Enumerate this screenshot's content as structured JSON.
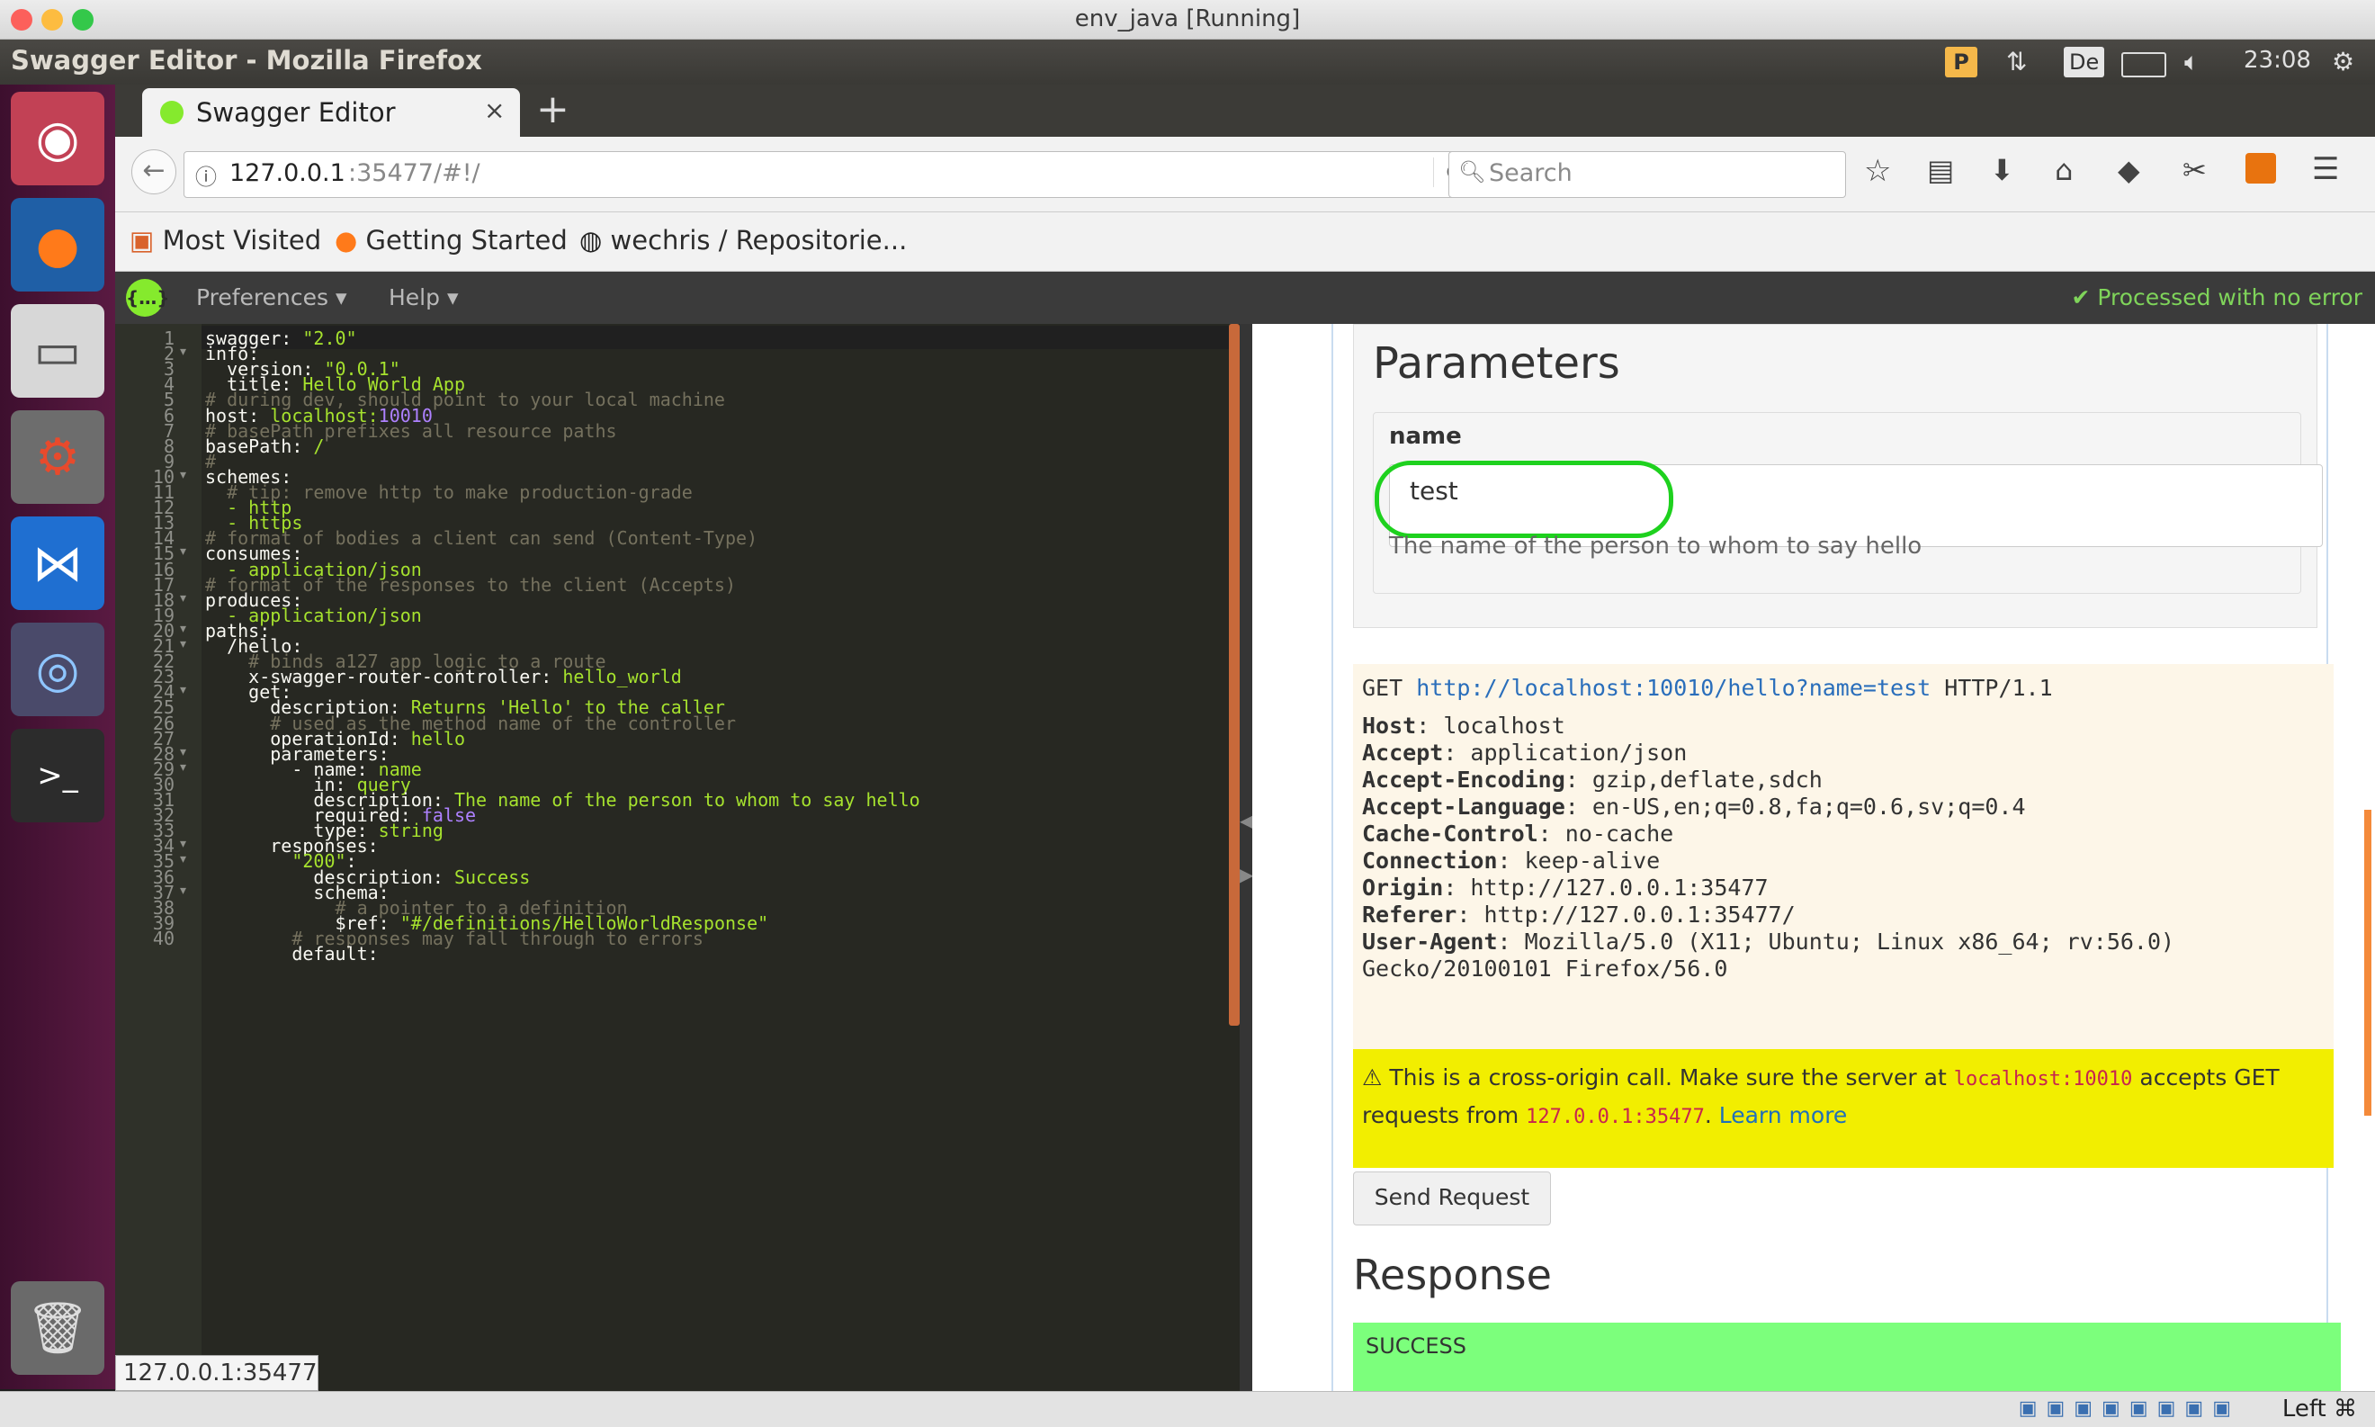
{
  "host_window": {
    "title": "env_java [Running]"
  },
  "ubuntu_panel": {
    "window_title": "Swagger Editor - Mozilla Firefox",
    "keyboard_layout": "De",
    "clock": "23:08"
  },
  "launcher": {
    "items": [
      "ubuntu-dash",
      "firefox",
      "files",
      "system-settings",
      "vscode",
      "chromium",
      "terminal",
      "trash"
    ]
  },
  "browser": {
    "tab_title": "Swagger Editor",
    "url_host": "127.0.0.1",
    "url_rest": ":35477/#!/",
    "search_placeholder": "Search",
    "bookmarks": [
      "Most Visited",
      "Getting Started",
      "wechris / Repositorie..."
    ],
    "status_url": "127.0.0.1:35477"
  },
  "swagger": {
    "menu": [
      "Preferences",
      "Help"
    ],
    "status": "Processed with no error"
  },
  "editor": {
    "line_numbers": [
      "1",
      "2",
      "3",
      "4",
      "5",
      "6",
      "7",
      "8",
      "9",
      "10",
      "11",
      "12",
      "13",
      "14",
      "15",
      "16",
      "17",
      "18",
      "19",
      "20",
      "21",
      "22",
      "23",
      "24",
      "25",
      "26",
      "27",
      "28",
      "29",
      "30",
      "31",
      "32",
      "33",
      "34",
      "35",
      "36",
      "37",
      "38",
      "39",
      "40"
    ],
    "folded_lines": [
      "2",
      "10",
      "15",
      "18",
      "20",
      "21",
      "24",
      "28",
      "29",
      "34",
      "35",
      "37"
    ],
    "lines": [
      [
        {
          "t": "k",
          "v": "swagger: "
        },
        {
          "t": "s",
          "v": "\"2.0\""
        }
      ],
      [
        {
          "t": "k",
          "v": "info:"
        }
      ],
      [
        {
          "t": "k",
          "v": "  version: "
        },
        {
          "t": "s",
          "v": "\"0.0.1\""
        }
      ],
      [
        {
          "t": "k",
          "v": "  title: "
        },
        {
          "t": "s",
          "v": "Hello World App"
        }
      ],
      [
        {
          "t": "c",
          "v": "# during dev, should point to your local machine"
        }
      ],
      [
        {
          "t": "k",
          "v": "host: "
        },
        {
          "t": "s",
          "v": "localhost:"
        },
        {
          "t": "n",
          "v": "10010"
        }
      ],
      [
        {
          "t": "c",
          "v": "# basePath prefixes all resource paths"
        }
      ],
      [
        {
          "t": "k",
          "v": "basePath: "
        },
        {
          "t": "s",
          "v": "/"
        }
      ],
      [
        {
          "t": "c",
          "v": "#"
        }
      ],
      [
        {
          "t": "k",
          "v": "schemes:"
        }
      ],
      [
        {
          "t": "c",
          "v": "  # tip: remove http to make production-grade"
        }
      ],
      [
        {
          "t": "s",
          "v": "  - http"
        }
      ],
      [
        {
          "t": "s",
          "v": "  - https"
        }
      ],
      [
        {
          "t": "c",
          "v": "# format of bodies a client can send (Content-Type)"
        }
      ],
      [
        {
          "t": "k",
          "v": "consumes:"
        }
      ],
      [
        {
          "t": "s",
          "v": "  - application/json"
        }
      ],
      [
        {
          "t": "c",
          "v": "# format of the responses to the client (Accepts)"
        }
      ],
      [
        {
          "t": "k",
          "v": "produces:"
        }
      ],
      [
        {
          "t": "s",
          "v": "  - application/json"
        }
      ],
      [
        {
          "t": "k",
          "v": "paths:"
        }
      ],
      [
        {
          "t": "k",
          "v": "  /hello:"
        }
      ],
      [
        {
          "t": "c",
          "v": "    # binds a127 app logic to a route"
        }
      ],
      [
        {
          "t": "k",
          "v": "    x-swagger-router-controller: "
        },
        {
          "t": "s",
          "v": "hello_world"
        }
      ],
      [
        {
          "t": "k",
          "v": "    get:"
        }
      ],
      [
        {
          "t": "k",
          "v": "      description: "
        },
        {
          "t": "s",
          "v": "Returns 'Hello' to the caller"
        }
      ],
      [
        {
          "t": "c",
          "v": "      # used as the method name of the controller"
        }
      ],
      [
        {
          "t": "k",
          "v": "      operationId: "
        },
        {
          "t": "s",
          "v": "hello"
        }
      ],
      [
        {
          "t": "k",
          "v": "      parameters:"
        }
      ],
      [
        {
          "t": "k",
          "v": "        - name: "
        },
        {
          "t": "s",
          "v": "name"
        }
      ],
      [
        {
          "t": "k",
          "v": "          in: "
        },
        {
          "t": "s",
          "v": "query"
        }
      ],
      [
        {
          "t": "k",
          "v": "          description: "
        },
        {
          "t": "s",
          "v": "The name of the person to whom to say hello"
        }
      ],
      [
        {
          "t": "k",
          "v": "          required: "
        },
        {
          "t": "n",
          "v": "false"
        }
      ],
      [
        {
          "t": "k",
          "v": "          type: "
        },
        {
          "t": "s",
          "v": "string"
        }
      ],
      [
        {
          "t": "k",
          "v": "      responses:"
        }
      ],
      [
        {
          "t": "s",
          "v": "        \"200\""
        },
        {
          "t": "k",
          "v": ":"
        }
      ],
      [
        {
          "t": "k",
          "v": "          description: "
        },
        {
          "t": "s",
          "v": "Success"
        }
      ],
      [
        {
          "t": "k",
          "v": "          schema:"
        }
      ],
      [
        {
          "t": "c",
          "v": "            # a pointer to a definition"
        }
      ],
      [
        {
          "t": "k",
          "v": "            $ref: "
        },
        {
          "t": "s",
          "v": "\"#/definitions/HelloWorldResponse\""
        }
      ],
      [
        {
          "t": "c",
          "v": "        # responses may fall through to errors"
        }
      ],
      [
        {
          "t": "k",
          "v": "        default:"
        }
      ]
    ]
  },
  "preview": {
    "parameters_title": "Parameters",
    "param_name": "name",
    "param_value": "test",
    "param_description": "The name of the person to whom to say hello",
    "request": {
      "method": "GET",
      "url": "http://localhost:10010/hello?name=test",
      "protocol": "HTTP/1.1",
      "headers": [
        {
          "k": "Host",
          "v": "localhost"
        },
        {
          "k": "Accept",
          "v": "application/json"
        },
        {
          "k": "Accept-Encoding",
          "v": "gzip,deflate,sdch"
        },
        {
          "k": "Accept-Language",
          "v": "en-US,en;q=0.8,fa;q=0.6,sv;q=0.4"
        },
        {
          "k": "Cache-Control",
          "v": "no-cache"
        },
        {
          "k": "Connection",
          "v": "keep-alive"
        },
        {
          "k": "Origin",
          "v": "http://127.0.0.1:35477"
        },
        {
          "k": "Referer",
          "v": "http://127.0.0.1:35477/"
        },
        {
          "k": "User-Agent",
          "v": "Mozilla/5.0 (X11; Ubuntu; Linux x86_64; rv:56.0)"
        }
      ],
      "ua_continuation": "Gecko/20100101 Firefox/56.0"
    },
    "cors": {
      "prefix": "⚠ This is a cross-origin call. Make sure the server at",
      "server": "localhost:10010",
      "mid": "accepts GET requests from",
      "origin": "127.0.0.1:35477",
      "sep": ".",
      "learn_more": "Learn more"
    },
    "send_button": "Send Request",
    "response_title": "Response",
    "response_status": "SUCCESS"
  },
  "vbox_status": {
    "host_key": "Left ⌘"
  },
  "colors": {
    "accent_green": "#1ed11e",
    "success_bg": "#7cff7c",
    "warning_bg": "#f2ee00",
    "launcher_bg": "#5a1a42"
  }
}
